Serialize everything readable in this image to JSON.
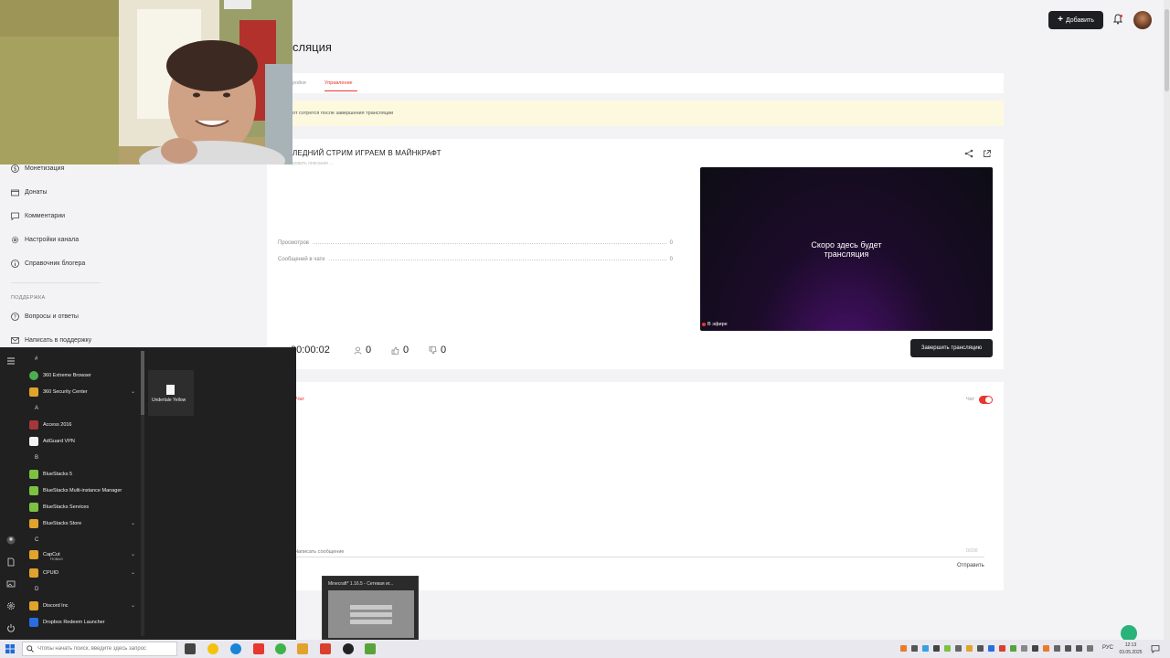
{
  "header": {
    "page_title": "сляция",
    "add_button": "Добавить"
  },
  "tabs": [
    {
      "label": "ройки",
      "active": false
    },
    {
      "label": "Управление",
      "active": true
    }
  ],
  "notice": "от сотрется после завершения трансляции",
  "stream": {
    "title": "ЛЕДНИЙ СТРИМ ИГРАЕМ В МАЙНКРАФТ",
    "subtitle": "ровать описание ...",
    "stats": [
      {
        "label": "Просмотров",
        "value": "0"
      },
      {
        "label": "Сообщений в чате",
        "value": "0"
      }
    ],
    "preview_text_line1": "Скоро здесь будет",
    "preview_text_line2": "трансляция",
    "live_label": "В эфире",
    "timer": "00:00:02",
    "viewers": "0",
    "likes": "0",
    "dislikes": "0",
    "end_button": "Завершить трансляцию"
  },
  "chat": {
    "tab_label": "Чат",
    "toggle_label": "Чат",
    "toggle_on": true,
    "input_placeholder": "Написать сообщение",
    "counter": "0/200",
    "send_label": "Отправить"
  },
  "sidebar": {
    "items": [
      {
        "label": "Монетизация",
        "icon": "dollar-icon"
      },
      {
        "label": "Донаты",
        "icon": "wallet-icon"
      },
      {
        "label": "Комментарии",
        "icon": "comment-icon"
      },
      {
        "label": "Настройки канала",
        "icon": "gear-icon"
      },
      {
        "label": "Справочник блогера",
        "icon": "info-icon"
      }
    ],
    "section_title": "ПОДДЕРЖКА",
    "support_items": [
      {
        "label": "Вопросы и ответы",
        "icon": "question-icon"
      },
      {
        "label": "Написать в поддержку",
        "icon": "mail-icon"
      }
    ]
  },
  "start_menu": {
    "sections": [
      {
        "letter": "#",
        "items": [
          {
            "label": "360 Extreme Browser",
            "color": "#4caf50"
          },
          {
            "label": "360 Security Center",
            "color": "#e0a32b",
            "folder": true
          }
        ]
      },
      {
        "letter": "A",
        "items": [
          {
            "label": "Access 2016",
            "color": "#a4373a"
          },
          {
            "label": "AdGuard VPN",
            "color": "#ffffff"
          }
        ]
      },
      {
        "letter": "B",
        "items": [
          {
            "label": "BlueStacks 5",
            "color": "#7cc242"
          },
          {
            "label": "BlueStacks Multi-instance Manager",
            "color": "#7cc242"
          },
          {
            "label": "BlueStacks Services",
            "color": "#7cc242"
          },
          {
            "label": "BlueStacks Store",
            "color": "#e0a32b",
            "folder": true
          }
        ]
      },
      {
        "letter": "C",
        "items": [
          {
            "label": "CapCut",
            "color": "#e0a32b",
            "folder": true,
            "sub": "Новые"
          },
          {
            "label": "CPUID",
            "color": "#e0a32b",
            "folder": true
          }
        ]
      },
      {
        "letter": "D",
        "items": [
          {
            "label": "Discord Inc",
            "color": "#e0a32b",
            "folder": true
          },
          {
            "label": "Dropbox Redeem Launcher",
            "color": "#2a6de1"
          }
        ]
      }
    ],
    "tile_label": "Undertale Yellow"
  },
  "taskbar": {
    "search_placeholder": "Чтобы начать поиск, введите здесь запрос",
    "thumbnail_title": "Minecraft* 1.16.5 - Сетевая иг...",
    "language": "РУС",
    "time": "12:13",
    "date": "03.05.2025"
  }
}
